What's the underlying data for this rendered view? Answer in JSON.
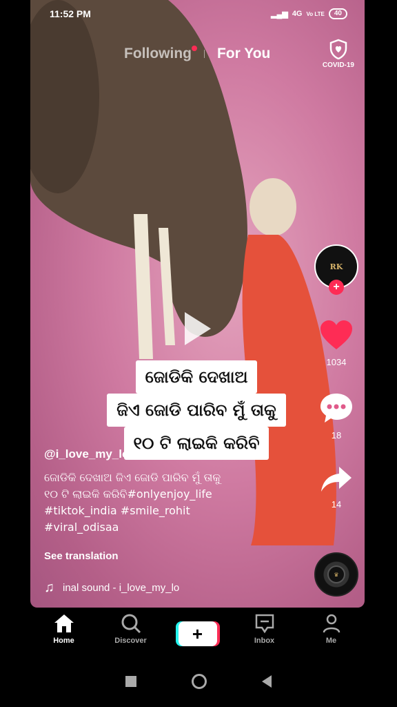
{
  "status_bar": {
    "time": "11:52 PM",
    "network": "4G",
    "volte": "Vo LTE",
    "battery": "40"
  },
  "header": {
    "tab_following": "Following",
    "tab_for_you": "For You",
    "covid_label": "COVID-19"
  },
  "video": {
    "overlay_caption_lines": [
      "ଜୋଡିକି ଦେଖାଅ",
      "ଜିଏ ଜୋଡି ପାରିବ ମୁଁ ତାକୁ",
      "୧୦ ଟି ଲାଇକି କରିବି"
    ]
  },
  "rail": {
    "avatar_text": "RK",
    "likes": "1034",
    "comments": "18",
    "shares": "14"
  },
  "post": {
    "username": "@i_love_my_love_r.k",
    "description_lines": [
      "ଜୋଡିକି ଦେଖାଅ ଜିଏ ଜୋଡି ପାରିବ ମୁଁ ତାକୁ",
      "୧୦ ଟି ଲାଇକି କରିବି#onlyenjoy_life",
      "#tiktok_india #smile_rohit",
      "#viral_odisaa"
    ],
    "see_translation": "See translation",
    "music": "inal sound - i_love_my_lo"
  },
  "nav": {
    "home": "Home",
    "discover": "Discover",
    "create": "+",
    "inbox": "Inbox",
    "me": "Me"
  },
  "colors": {
    "accent_red": "#fe2c55",
    "accent_cyan": "#25f4ee"
  }
}
